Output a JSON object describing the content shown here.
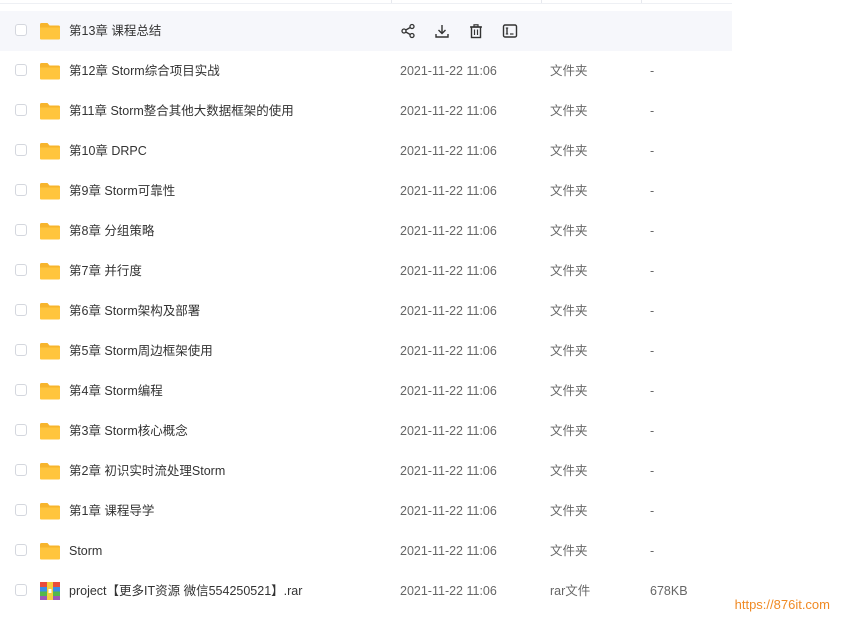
{
  "actions": {
    "share_icon": "share-icon",
    "download_icon": "download-icon",
    "delete_icon": "trash-icon",
    "more_icon": "rename-icon"
  },
  "files": [
    {
      "name": "第13章 课程总结",
      "date": "",
      "type": "",
      "size": "",
      "kind": "folder",
      "hovered": true
    },
    {
      "name": "第12章 Storm综合项目实战",
      "date": "2021-11-22 11:06",
      "type": "文件夹",
      "size": "-",
      "kind": "folder"
    },
    {
      "name": "第11章 Storm整合其他大数据框架的使用",
      "date": "2021-11-22 11:06",
      "type": "文件夹",
      "size": "-",
      "kind": "folder"
    },
    {
      "name": "第10章 DRPC",
      "date": "2021-11-22 11:06",
      "type": "文件夹",
      "size": "-",
      "kind": "folder"
    },
    {
      "name": "第9章 Storm可靠性",
      "date": "2021-11-22 11:06",
      "type": "文件夹",
      "size": "-",
      "kind": "folder"
    },
    {
      "name": "第8章 分组策略",
      "date": "2021-11-22 11:06",
      "type": "文件夹",
      "size": "-",
      "kind": "folder"
    },
    {
      "name": "第7章 并行度",
      "date": "2021-11-22 11:06",
      "type": "文件夹",
      "size": "-",
      "kind": "folder"
    },
    {
      "name": "第6章 Storm架构及部署",
      "date": "2021-11-22 11:06",
      "type": "文件夹",
      "size": "-",
      "kind": "folder"
    },
    {
      "name": "第5章 Storm周边框架使用",
      "date": "2021-11-22 11:06",
      "type": "文件夹",
      "size": "-",
      "kind": "folder"
    },
    {
      "name": "第4章 Storm编程",
      "date": "2021-11-22 11:06",
      "type": "文件夹",
      "size": "-",
      "kind": "folder"
    },
    {
      "name": "第3章 Storm核心概念",
      "date": "2021-11-22 11:06",
      "type": "文件夹",
      "size": "-",
      "kind": "folder"
    },
    {
      "name": "第2章 初识实时流处理Storm",
      "date": "2021-11-22 11:06",
      "type": "文件夹",
      "size": "-",
      "kind": "folder"
    },
    {
      "name": "第1章 课程导学",
      "date": "2021-11-22 11:06",
      "type": "文件夹",
      "size": "-",
      "kind": "folder"
    },
    {
      "name": "Storm",
      "date": "2021-11-22 11:06",
      "type": "文件夹",
      "size": "-",
      "kind": "folder"
    },
    {
      "name": "project【更多IT资源 微信554250521】.rar",
      "date": "2021-11-22 11:06",
      "type": "rar文件",
      "size": "678KB",
      "kind": "rar"
    }
  ],
  "watermark": "https://876it.com",
  "colors": {
    "folder": "#FFC53D",
    "folder_tab": "#F7B52C",
    "watermark": "#F08A24",
    "hover_bg": "#F6F7FB"
  }
}
